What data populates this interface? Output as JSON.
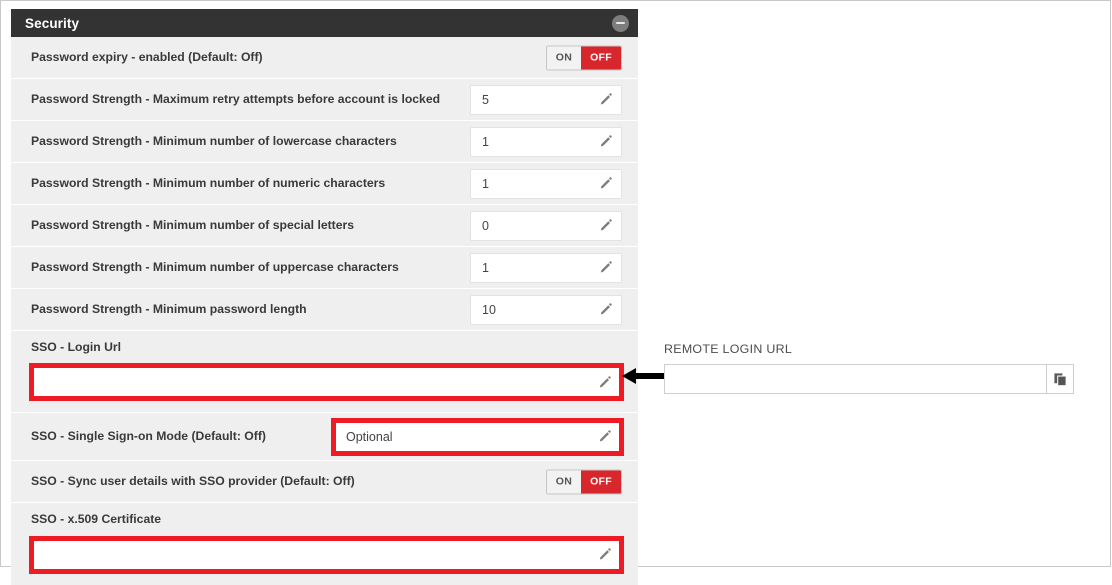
{
  "panel": {
    "title": "Security",
    "collapse_icon": "minus-circle-icon",
    "rows": [
      {
        "label": "Password expiry - enabled (Default: Off)",
        "type": "toggle",
        "on_label": "ON",
        "off_label": "OFF",
        "state": "OFF"
      },
      {
        "label": "Password Strength - Maximum retry attempts before account is locked",
        "type": "value",
        "value": "5",
        "edit_icon": "pencil-icon"
      },
      {
        "label": "Password Strength - Minimum number of lowercase characters",
        "type": "value",
        "value": "1",
        "edit_icon": "pencil-icon"
      },
      {
        "label": "Password Strength - Minimum number of numeric characters",
        "type": "value",
        "value": "1",
        "edit_icon": "pencil-icon"
      },
      {
        "label": "Password Strength - Minimum number of special letters",
        "type": "value",
        "value": "0",
        "edit_icon": "pencil-icon"
      },
      {
        "label": "Password Strength - Minimum number of uppercase characters",
        "type": "value",
        "value": "1",
        "edit_icon": "pencil-icon"
      },
      {
        "label": "Password Strength - Minimum password length",
        "type": "value",
        "value": "10",
        "edit_icon": "pencil-icon"
      },
      {
        "label": "SSO - Login Url",
        "type": "wide-field",
        "value": "",
        "edit_icon": "pencil-icon",
        "highlighted": true
      },
      {
        "label": "SSO - Single Sign-on Mode (Default: Off)",
        "type": "value-highlighted",
        "value": "Optional",
        "edit_icon": "pencil-icon",
        "highlighted": true
      },
      {
        "label": "SSO - Sync user details with SSO provider (Default: Off)",
        "type": "toggle",
        "on_label": "ON",
        "off_label": "OFF",
        "state": "OFF"
      },
      {
        "label": "SSO - x.509 Certificate",
        "type": "wide-field",
        "value": "",
        "edit_icon": "pencil-icon",
        "highlighted": true
      }
    ]
  },
  "remote_login": {
    "label": "REMOTE LOGIN URL",
    "value": "",
    "placeholder": "",
    "copy_icon": "copy-icon"
  },
  "annotation": {
    "arrow_icon": "arrow-left-icon"
  },
  "colors": {
    "header_bg": "#333333",
    "row_bg": "#efefef",
    "highlight": "#ed1c24",
    "toggle_active": "#d8272c"
  }
}
